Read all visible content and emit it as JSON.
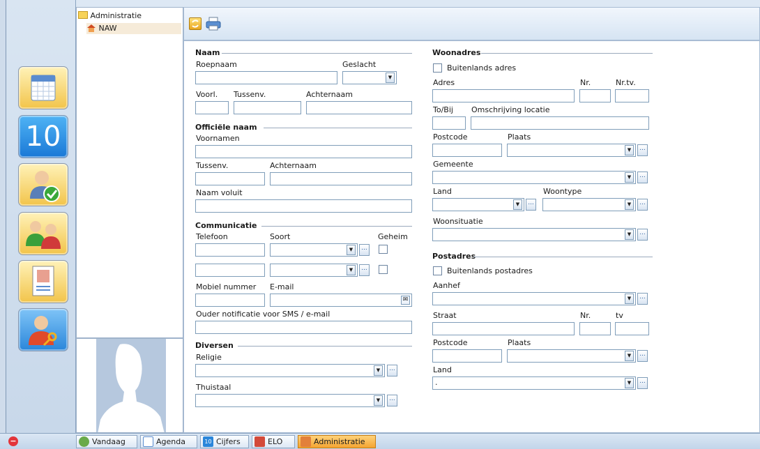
{
  "tree": {
    "root": "Administratie",
    "child": "NAW"
  },
  "left_icons": [
    {
      "name": "agenda-icon"
    },
    {
      "name": "cijfers-icon",
      "text": "10"
    },
    {
      "name": "aanwezigheid-icon"
    },
    {
      "name": "groepen-icon"
    },
    {
      "name": "leerlingkaart-icon"
    },
    {
      "name": "gebruiker-sleutel-icon"
    }
  ],
  "form": {
    "naam": {
      "title": "Naam",
      "roepnaam": "Roepnaam",
      "geslacht": "Geslacht",
      "voorl": "Voorl.",
      "tussenv": "Tussenv.",
      "achternaam": "Achternaam"
    },
    "officiele": {
      "title": "Officiële naam",
      "voornamen": "Voornamen",
      "tussenv": "Tussenv.",
      "achternaam": "Achternaam",
      "naam_voluit": "Naam voluit"
    },
    "communicatie": {
      "title": "Communicatie",
      "telefoon": "Telefoon",
      "soort": "Soort",
      "geheim": "Geheim",
      "mobiel": "Mobiel nummer",
      "email": "E-mail",
      "ouder": "Ouder notificatie voor SMS / e-mail"
    },
    "diversen": {
      "title": "Diversen",
      "religie": "Religie",
      "thuistaal": "Thuistaal"
    },
    "woonadres": {
      "title": "Woonadres",
      "buitenlands": "Buitenlands adres",
      "adres": "Adres",
      "nr": "Nr.",
      "nrtv": "Nr.tv.",
      "tobij": "To/Bij",
      "omschrijving": "Omschrijving locatie",
      "postcode": "Postcode",
      "plaats": "Plaats",
      "gemeente": "Gemeente",
      "land": "Land",
      "woontype": "Woontype",
      "woonsituatie": "Woonsituatie"
    },
    "postadres": {
      "title": "Postadres",
      "buitenlands": "Buitenlands postadres",
      "aanhef": "Aanhef",
      "straat": "Straat",
      "nr": "Nr.",
      "tv": "tv",
      "postcode": "Postcode",
      "plaats": "Plaats",
      "land": "Land",
      "land_value": "."
    }
  },
  "taskbar": {
    "items": [
      "Vandaag",
      "Agenda",
      "Cijfers",
      "ELO",
      "Administratie"
    ],
    "active": "Administratie"
  },
  "colors": {
    "accent": "#f4a431",
    "panel_bg": "#dde8f4",
    "field_border": "#7f9db9"
  }
}
